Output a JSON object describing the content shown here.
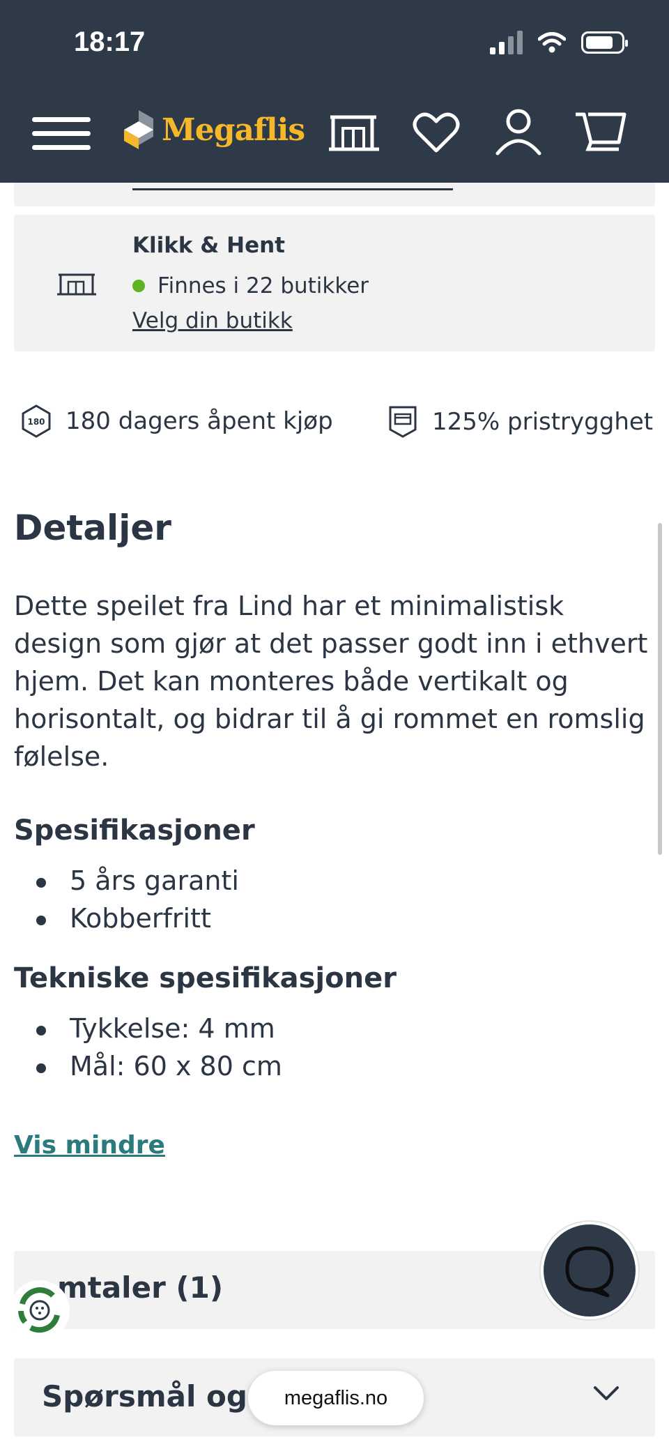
{
  "status_bar": {
    "time": "18:17"
  },
  "header": {
    "brand": "Megaflis",
    "icons": [
      "menu-icon",
      "store-icon",
      "heart-icon",
      "user-icon",
      "cart-icon"
    ],
    "background_color": "#2f3a48",
    "brand_color": "#f6b82a"
  },
  "click_collect": {
    "title": "Klikk & Hent",
    "stock_text": "Finnes i 22 butikker",
    "stock_status_color": "#5fb322",
    "link": "Velg din butikk"
  },
  "trust": {
    "open_purchase_badge": "180",
    "open_purchase": "180 dagers åpent kjøp",
    "price_guarantee": "125% pristrygghet"
  },
  "details": {
    "heading": "Detaljer",
    "description": "Dette speilet fra Lind har et minimalistisk design som gjør at det passer godt inn i ethvert hjem. Det kan monteres både vertikalt og horisontalt, og bidrar til å gi rommet en romslig følelse.",
    "specs_heading": "Spesifikasjoner",
    "specs": [
      "5 års garanti",
      "Kobberfritt"
    ],
    "tech_heading": "Tekniske spesifikasjoner",
    "tech_specs": [
      "Tykkelse: 4 mm",
      "Mål: 60 x 80 cm"
    ],
    "show_less": "Vis mindre"
  },
  "accordions": {
    "reviews": "mtaler (1)",
    "questions": "Spørsmål og s"
  },
  "browser": {
    "url": "megaflis.no"
  }
}
